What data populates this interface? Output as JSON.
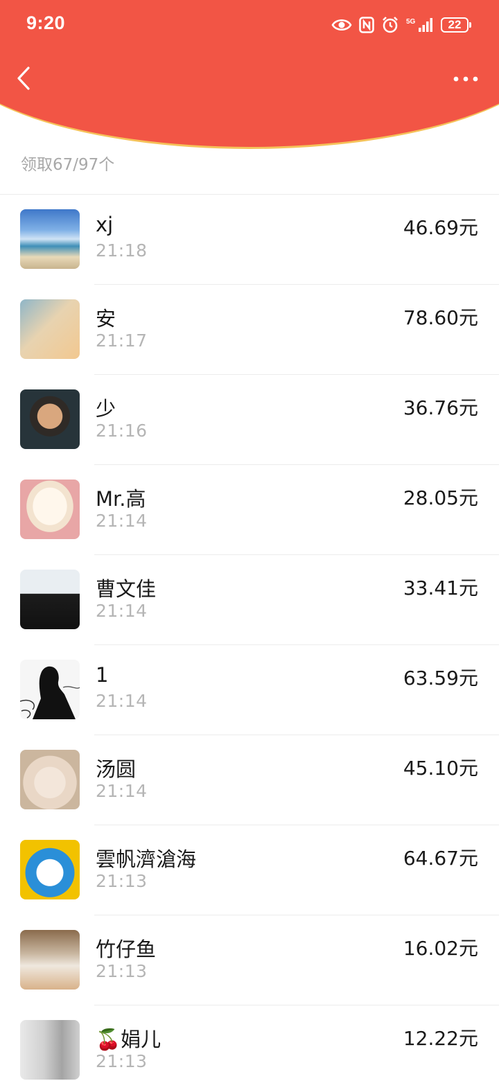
{
  "status_bar": {
    "time": "9:20",
    "network": "5G",
    "battery": "22",
    "icons": [
      "eye-icon",
      "nfc-icon",
      "alarm-icon",
      "signal-icon",
      "battery-icon"
    ]
  },
  "nav": {
    "back_icon": "chevron-left-icon",
    "more_icon": "more-dots-icon"
  },
  "colors": {
    "header_red": "#f25545",
    "header_border": "#f5c25a",
    "text_primary": "#1a1a1a",
    "text_secondary": "#b5b5b5"
  },
  "summary": "领取67/97个",
  "records": [
    {
      "name": "xj",
      "time": "21:18",
      "amount": "46.69元",
      "avatar": "avatar-beach"
    },
    {
      "name": "安",
      "time": "21:17",
      "amount": "78.60元",
      "avatar": "avatar-cat"
    },
    {
      "name": "少",
      "time": "21:16",
      "amount": "36.76元",
      "avatar": "avatar-man"
    },
    {
      "name": "Mr.高",
      "time": "21:14",
      "amount": "28.05元",
      "avatar": "avatar-dog"
    },
    {
      "name": "曹文佳",
      "time": "21:14",
      "amount": "33.41元",
      "avatar": "avatar-suit"
    },
    {
      "name": "1",
      "time": "21:14",
      "amount": "63.59元",
      "avatar": "avatar-sketch"
    },
    {
      "name": "汤圆",
      "time": "21:14",
      "amount": "45.10元",
      "avatar": "avatar-kitten"
    },
    {
      "name": "雲帆濟滄海",
      "time": "21:13",
      "amount": "64.67元",
      "avatar": "avatar-doraemon"
    },
    {
      "name": "竹仔鱼",
      "time": "21:13",
      "amount": "16.02元",
      "avatar": "avatar-figure"
    },
    {
      "name": "🍒娟儿",
      "time": "21:13",
      "amount": "12.22元",
      "avatar": "avatar-face"
    }
  ]
}
